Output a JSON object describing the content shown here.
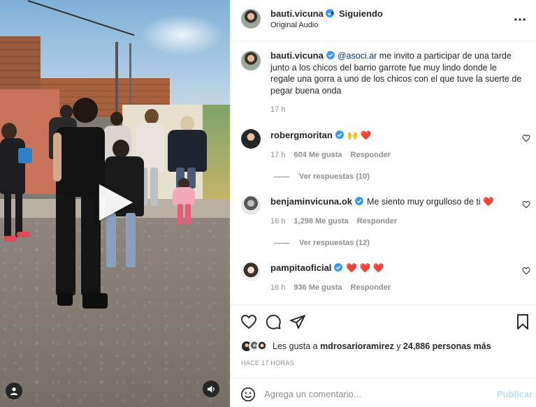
{
  "media": {
    "play_icon": "play-icon",
    "user_tag_icon": "user-tag-icon",
    "audio_icon": "speaker-icon"
  },
  "header": {
    "username": "bauti.vicuna",
    "separator": "•",
    "follow_status": "Siguiendo",
    "audio": "Original Audio"
  },
  "caption": {
    "username": "bauti.vicuna",
    "mention": "@asoci.ar",
    "text": " me invito a participar de una tarde junto a los chicos del barrio garrote fue muy lindo donde le regale una gorra a uno de los chicos con el que tuve la suerte de pegar buena onda",
    "time": "17 h"
  },
  "comments": [
    {
      "username": "robergmoritan",
      "text": "🙌 ❤️",
      "time": "17 h",
      "likes": "604 Me gusta",
      "reply": "Responder",
      "view_replies": "Ver respuestas (10)"
    },
    {
      "username": "benjaminvicuna.ok",
      "text": "Me siento muy orgulloso de ti ❤️",
      "time": "16 h",
      "likes": "1,298 Me gusta",
      "reply": "Responder",
      "view_replies": "Ver respuestas (12)"
    },
    {
      "username": "pampitaoficial",
      "text": "❤️ ❤️ ❤️",
      "time": "16 h",
      "likes": "936 Me gusta",
      "reply": "Responder"
    }
  ],
  "likes": {
    "prefix": "Les gusta a ",
    "user": "mdrosarioramirez",
    "middle": " y ",
    "count": "24,886 personas más"
  },
  "time_ago": "HACE 17 HORAS",
  "add_comment": {
    "placeholder": "Agrega un comentario...",
    "post_label": "Publicar"
  },
  "colors": {
    "verified": "#3897f0",
    "heart_red": "#ed4956",
    "link": "#00376b",
    "muted": "#8e8e8e",
    "post_disabled": "#b2dffc"
  }
}
